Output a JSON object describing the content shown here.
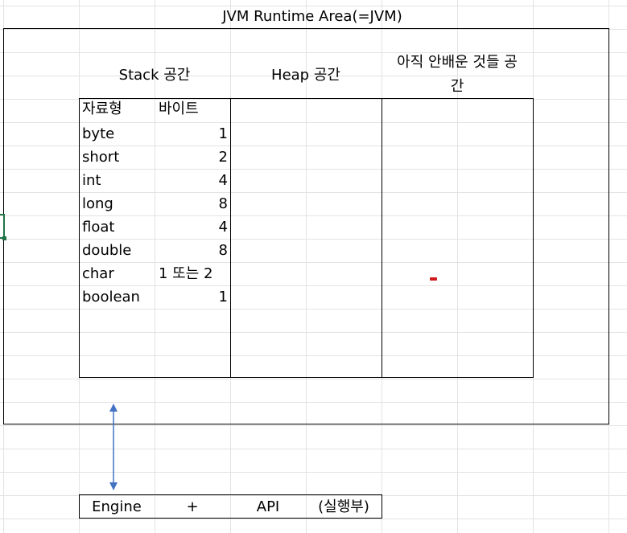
{
  "title": "JVM Runtime Area(=JVM)",
  "sections": {
    "stack": "Stack 공간",
    "heap": "Heap 공간",
    "unlearned_line1": "아직 안배운 것들 공",
    "unlearned_line2": "간"
  },
  "table": {
    "headers": [
      "자료형",
      "바이트"
    ],
    "rows": [
      {
        "type": "byte",
        "bytes": "1"
      },
      {
        "type": "short",
        "bytes": "2"
      },
      {
        "type": "int",
        "bytes": "4"
      },
      {
        "type": "long",
        "bytes": "8"
      },
      {
        "type": "float",
        "bytes": "4"
      },
      {
        "type": "double",
        "bytes": "8"
      },
      {
        "type": "char",
        "bytes": "1 또는 2"
      },
      {
        "type": "boolean",
        "bytes": "1"
      }
    ]
  },
  "execution": {
    "engine": "Engine",
    "plus": "+",
    "api": "API",
    "label": "(실행부)"
  },
  "colors": {
    "arrow": "#4472c4",
    "red_mark": "#d0191b",
    "selection": "#217346",
    "grid": "#e3e3e3"
  }
}
